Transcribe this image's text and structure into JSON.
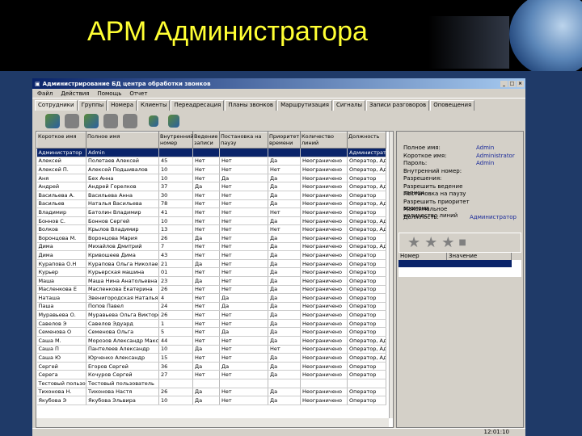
{
  "slide": {
    "title": "АРМ Администратора"
  },
  "window": {
    "title": "Администрирование БД центра обработки звонков",
    "controls": [
      "_",
      "□",
      "×"
    ]
  },
  "menu": [
    "Файл",
    "Действия",
    "Помощь",
    "Отчет"
  ],
  "tabs": [
    "Сотрудники",
    "Группы",
    "Номера",
    "Клиенты",
    "Переадресация",
    "Планы звонков",
    "Маршрутизация",
    "Сигналы",
    "Записи разговоров",
    "Оповещения"
  ],
  "grid": {
    "headers": [
      "Короткое имя",
      "Полное имя",
      "Внутренний номер",
      "Ведение записи",
      "Постановка на паузу",
      "Приоритет времени",
      "Количество линий",
      "Должность"
    ],
    "rows": [
      [
        "Администратор",
        "Admin",
        "",
        "",
        "",
        "",
        "",
        "Администратор"
      ],
      [
        "Алексей",
        "Полетаев Алексей",
        "45",
        "Нет",
        "Нет",
        "Да",
        "Неограничено",
        "Оператор, Адм"
      ],
      [
        "Алексей П.",
        "Алексей Подшивалов",
        "10",
        "Нет",
        "Нет",
        "Нет",
        "Неограничено",
        "Оператор, Адм"
      ],
      [
        "Аня",
        "Бех Анна",
        "10",
        "Нет",
        "Да",
        "Да",
        "Неограничено",
        "Оператор"
      ],
      [
        "Андрей",
        "Андрей Горелков",
        "37",
        "Да",
        "Нет",
        "Да",
        "Неограничено",
        "Оператор, Адм"
      ],
      [
        "Васильева А.",
        "Васильева Анна",
        "30",
        "Нет",
        "Нет",
        "Да",
        "Неограничено",
        "Оператор"
      ],
      [
        "Васильев",
        "Наталья Васильева",
        "78",
        "Нет",
        "Нет",
        "Да",
        "Неограничено",
        "Оператор, Адм"
      ],
      [
        "Владимир",
        "Батолин Владимир",
        "41",
        "Нет",
        "Нет",
        "Нет",
        "Неограничено",
        "Оператор"
      ],
      [
        "Боннов С.",
        "Боннов Сергей",
        "10",
        "Нет",
        "Нет",
        "Да",
        "Неограничено",
        "Оператор, Адм"
      ],
      [
        "Волков",
        "Крылов Владимир",
        "13",
        "Нет",
        "Нет",
        "Нет",
        "Неограничено",
        "Оператор, Адм"
      ],
      [
        "Воронцова М.",
        "Воронцова Мария",
        "26",
        "Да",
        "Нет",
        "Да",
        "Неограничено",
        "Оператор"
      ],
      [
        "Дима",
        "Михайлов Дмитрий",
        "7",
        "Нет",
        "Нет",
        "Да",
        "Неограничено",
        "Оператор, Адм"
      ],
      [
        "Дима",
        "Кривошеев Дима",
        "43",
        "Нет",
        "Нет",
        "Да",
        "Неограничено",
        "Оператор"
      ],
      [
        "Курапова О.Н",
        "Курапова Ольга Николаевна",
        "21",
        "Да",
        "Нет",
        "Да",
        "Неограничено",
        "Оператор"
      ],
      [
        "Курьер",
        "Курьерская машина",
        "01",
        "Нет",
        "Нет",
        "Да",
        "Неограничено",
        "Оператор"
      ],
      [
        "Маша",
        "Маша Нина Анатольевна",
        "23",
        "Да",
        "Нет",
        "Да",
        "Неограничено",
        "Оператор"
      ],
      [
        "Масленкова Е",
        "Масленкова Екатерина",
        "26",
        "Нет",
        "Нет",
        "Да",
        "Неограничено",
        "Оператор"
      ],
      [
        "Наташа",
        "Звенигородская Наталья",
        "4",
        "Нет",
        "Да",
        "Да",
        "Неограничено",
        "Оператор"
      ],
      [
        "Паша",
        "Попов Павел",
        "24",
        "Нет",
        "Да",
        "Да",
        "Неограничено",
        "Оператор"
      ],
      [
        "Муравьева О.",
        "Муравьева Ольга Викторовна",
        "26",
        "Нет",
        "Нет",
        "Да",
        "Неограничено",
        "Оператор"
      ],
      [
        "Савелов Э",
        "Савелов Эдуард",
        "1",
        "Нет",
        "Нет",
        "Да",
        "Неограничено",
        "Оператор"
      ],
      [
        "Семенова О",
        "Семенова Ольга",
        "5",
        "Нет",
        "Да",
        "Да",
        "Неограничено",
        "Оператор"
      ],
      [
        "Саша М.",
        "Морозов Александр Максимович",
        "44",
        "Нет",
        "Нет",
        "Да",
        "Неограничено",
        "Оператор, Адм"
      ],
      [
        "Саша П",
        "Пантелеев Александр",
        "10",
        "Да",
        "Нет",
        "Нет",
        "Неограничено",
        "Оператор, Адм"
      ],
      [
        "Саша Ю",
        "Юрченко Александр",
        "15",
        "Нет",
        "Нет",
        "Да",
        "Неограничено",
        "Оператор, Адм"
      ],
      [
        "Сергей",
        "Егоров Сергей",
        "36",
        "Да",
        "Да",
        "Да",
        "Неограничено",
        "Оператор"
      ],
      [
        "Серега",
        "Кочуров Сергей",
        "27",
        "Нет",
        "Нет",
        "Да",
        "Неограничено",
        "Оператор"
      ],
      [
        "Тестовый пользователь",
        "Тестовый пользователь",
        "",
        "",
        "",
        "",
        "",
        ""
      ],
      [
        "Тихонова Н.",
        "Тихонова Настя",
        "26",
        "Да",
        "Нет",
        "Да",
        "Неограничено",
        "Оператор"
      ],
      [
        "Якубова Э",
        "Якубова Эльвира",
        "10",
        "Да",
        "Нет",
        "Да",
        "Неограничено",
        "Оператор"
      ]
    ]
  },
  "details": [
    {
      "k": "Полное имя:",
      "v": "Admin"
    },
    {
      "k": "Короткое имя:",
      "v": "Administrator"
    },
    {
      "k": "Пароль:",
      "v": "Admin"
    },
    {
      "k": "Внутренний номер:",
      "v": ""
    },
    {
      "k": "Разрешения:",
      "v": ""
    },
    {
      "k": "  Разрешить ведение записи",
      "v": ""
    },
    {
      "k": "Постановка на паузу",
      "v": ""
    },
    {
      "k": "  Разрешить приоритет времени",
      "v": ""
    },
    {
      "k": "Максимальное количество линий",
      "v": ""
    },
    {
      "k": "Должность:",
      "v": "Администратор"
    }
  ],
  "subgrid": {
    "headers": [
      "Номер",
      "Значение"
    ]
  },
  "status": {
    "time": "12:01:10"
  }
}
